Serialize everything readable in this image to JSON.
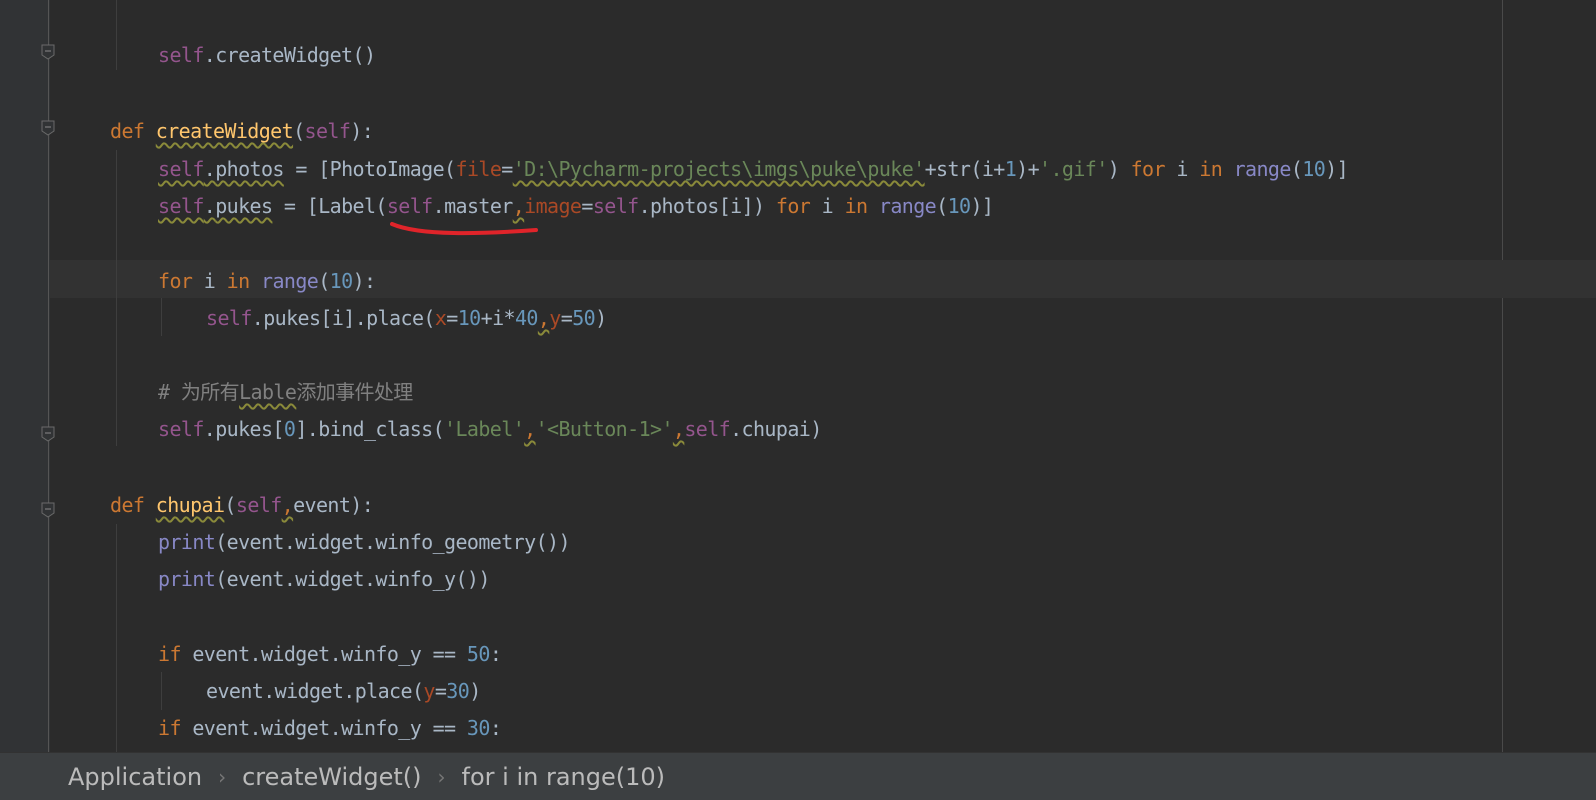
{
  "breadcrumb": {
    "items": [
      "Application",
      "createWidget()",
      "for i in range(10)"
    ]
  },
  "code": {
    "l1": {
      "a": "self",
      "b": ".createWidget()"
    },
    "l3": {
      "a": "def ",
      "b": "createWidget",
      "c": "(",
      "d": "self",
      "e": "):"
    },
    "l4": {
      "a": "self",
      "b": ".",
      "c": "photos",
      "d": " = [PhotoImage(",
      "e": "file",
      "f": "=",
      "g": "'D:\\Pycharm-projects\\imgs\\puke\\puke'",
      "h": "+str(i+",
      "i": "1",
      "j": ")+",
      "k": "'.gif'",
      "l": ") ",
      "m": "for",
      "n": " i ",
      "o": "in",
      "p": " ",
      "q": "range",
      "r": "(",
      "s": "10",
      "t": ")]"
    },
    "l5": {
      "a": "self",
      "b": ".",
      "c": "pukes",
      "d": " = [Label(",
      "e": "self",
      "f": ".master",
      "g": ",",
      "h": "image",
      "i": "=",
      "j": "self",
      "k": ".photos[i]) ",
      "l": "for",
      "m": " i ",
      "n": "in",
      "o": " ",
      "p": "range",
      "q": "(",
      "r": "10",
      "s": ")]"
    },
    "l7": {
      "a": "for",
      "b": " i ",
      "c": "in",
      "d": " ",
      "e": "range",
      "f": "(",
      "g": "10",
      "h": "):"
    },
    "l8": {
      "a": "self",
      "b": ".pukes[i].place(",
      "c": "x",
      "d": "=",
      "e": "10",
      "f": "+i*",
      "g": "40",
      "h": ",",
      "i": "y",
      "j": "=",
      "k": "50",
      "l": ")"
    },
    "l10": {
      "a": "# 为所有",
      "b": "Lable",
      "c": "添加事件处理"
    },
    "l11": {
      "a": "self",
      "b": ".pukes[",
      "c": "0",
      "d": "].bind_class(",
      "e": "'Label'",
      "f": ",",
      "g": "'<Button-1>'",
      "h": ",",
      "i": "self",
      "j": ".chupai)"
    },
    "l13": {
      "a": "def ",
      "b": "chupai",
      "c": "(",
      "d": "self",
      "e": ",",
      "f": "event):"
    },
    "l14": {
      "a": "print",
      "b": "(event.widget.winfo_geometry())"
    },
    "l15": {
      "a": "print",
      "b": "(event.widget.winfo_y())"
    },
    "l17": {
      "a": "if",
      "b": " event.widget.winfo_y == ",
      "c": "50",
      "d": ":"
    },
    "l18": {
      "a": "event.widget.place(",
      "b": "y",
      "c": "=",
      "d": "30",
      "e": ")"
    },
    "l19": {
      "a": "if",
      "b": " event.widget.winfo_y == ",
      "c": "30",
      "d": ":"
    }
  },
  "colors": {
    "background": "#2b2b2b",
    "keyword": "#cc7832",
    "self": "#94558d",
    "function": "#ffc66d",
    "string": "#6a8759",
    "number": "#6897bb",
    "annotation_mark": "#e0242a"
  },
  "icons": [
    "fold-icon",
    "breadcrumb-separator-icon"
  ]
}
